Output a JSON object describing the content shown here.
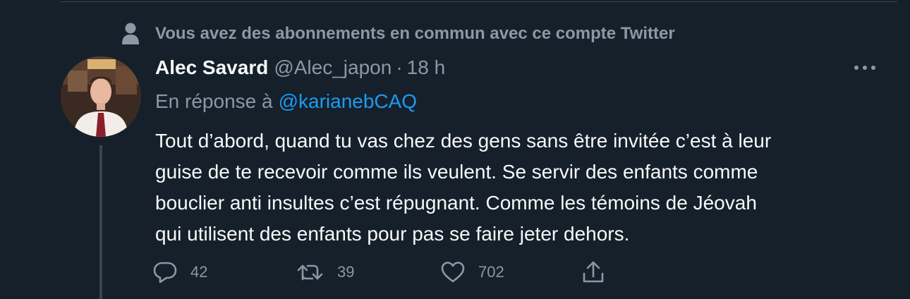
{
  "social_context": {
    "text": "Vous avez des abonnements en commun avec ce compte Twitter",
    "icon": "person-icon"
  },
  "tweet": {
    "author": {
      "display_name": "Alec Savard",
      "handle": "@Alec_japon"
    },
    "separator": "·",
    "time": "18 h",
    "reply_prefix": "En réponse à",
    "reply_mention": "@karianebCAQ",
    "text_lines": [
      "Tout d’abord, quand tu vas chez des gens sans être invitée c’est à leur",
      "guise de te recevoir comme ils veulent. Se servir des enfants comme",
      "bouclier anti insultes c’est répugnant. Comme les témoins de Jéovah",
      "qui utilisent des enfants pour pas se faire jeter dehors."
    ],
    "actions": {
      "reply_count": "42",
      "retweet_count": "39",
      "like_count": "702"
    }
  },
  "colors": {
    "background": "#15202b",
    "primary_text": "#f7f9f9",
    "secondary_text": "#8b98a5",
    "accent": "#1d9bf0",
    "divider": "#38444d"
  }
}
